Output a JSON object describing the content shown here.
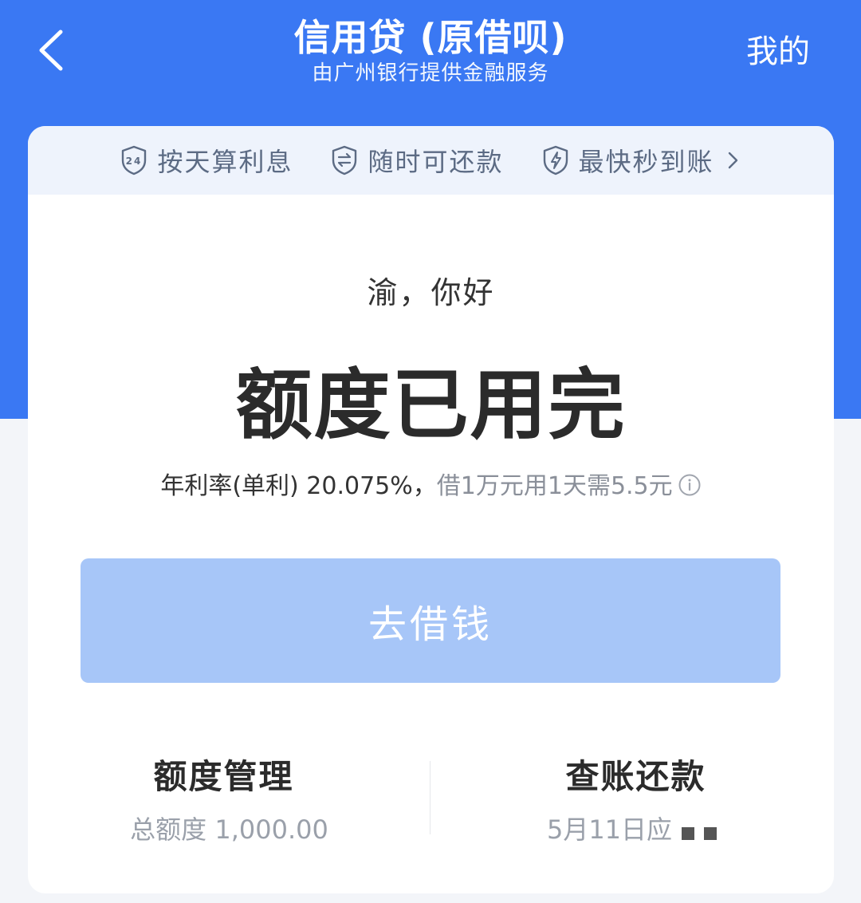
{
  "colors": {
    "brand_blue": "#3a78f3",
    "button_disabled": "#a7c6f8",
    "feature_bar_bg": "#eef3fc"
  },
  "header": {
    "title": "信用贷 (原借呗)",
    "subtitle": "由广州银行提供金融服务",
    "mine_label": "我的",
    "back_icon": "chevron-left-icon"
  },
  "features": [
    {
      "icon": "24h-shield-icon",
      "label": "按天算利息"
    },
    {
      "icon": "exchange-shield-icon",
      "label": "随时可还款"
    },
    {
      "icon": "lightning-shield-icon",
      "label": "最快秒到账"
    }
  ],
  "main": {
    "greeting": "渝，你好",
    "status": "额度已用完",
    "rate_label": "年利率(单利) 20.075%，",
    "rate_example": "借1万元用1天需5.5元",
    "borrow_button": "去借钱"
  },
  "bottom": {
    "left": {
      "title": "额度管理",
      "subtitle": "总额度 1,000.00"
    },
    "right": {
      "title": "查账还款",
      "subtitle": "5月11日应"
    }
  }
}
